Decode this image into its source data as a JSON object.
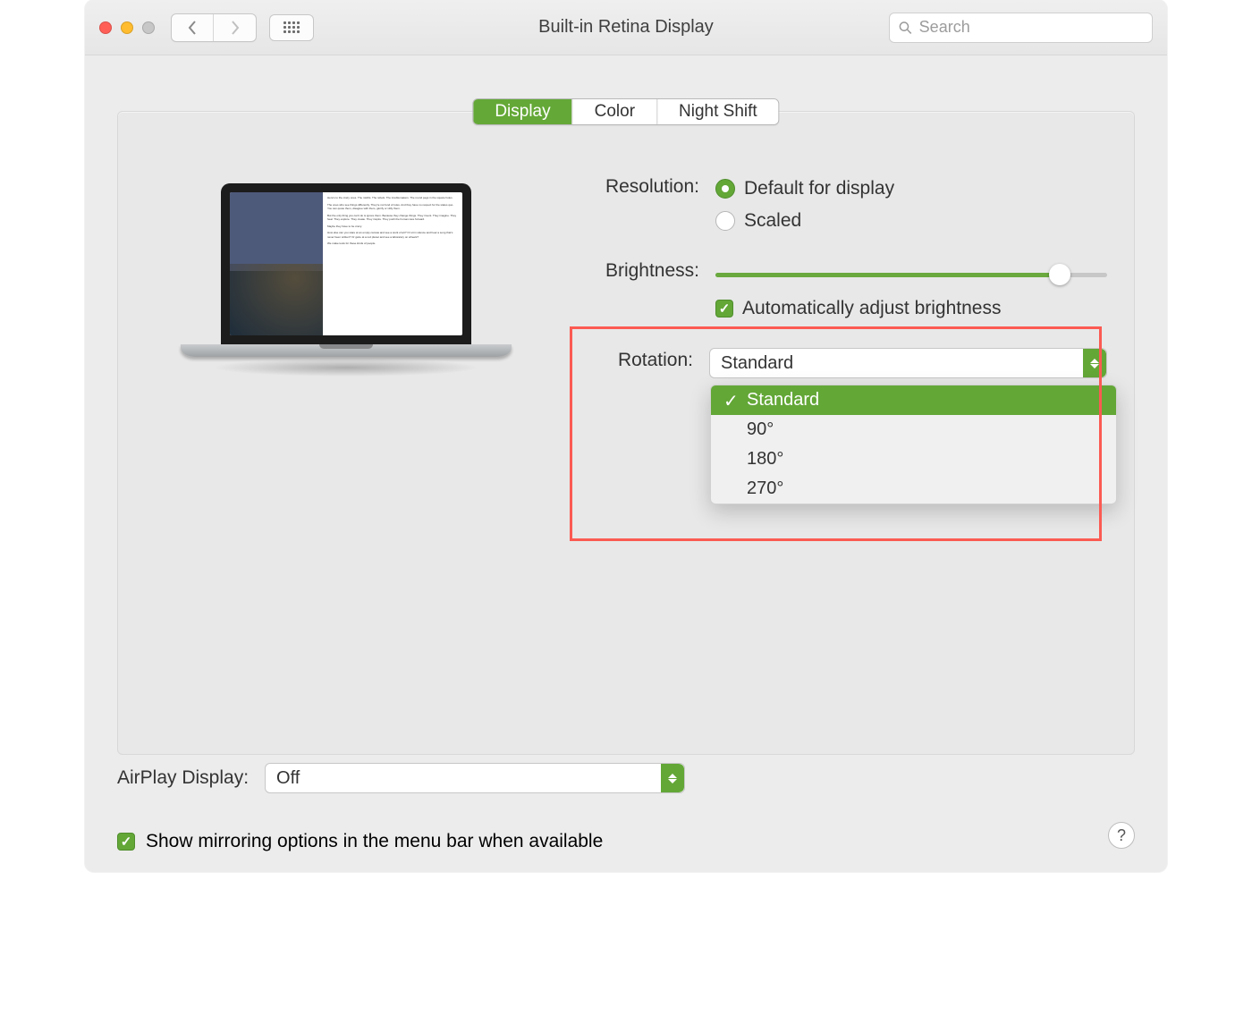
{
  "header": {
    "title": "Built-in Retina Display",
    "search_placeholder": "Search"
  },
  "tabs": {
    "display": "Display",
    "color": "Color",
    "night_shift": "Night Shift"
  },
  "labels": {
    "resolution": "Resolution:",
    "brightness": "Brightness:",
    "rotation": "Rotation:",
    "airplay": "AirPlay Display:"
  },
  "resolution": {
    "default": "Default for display",
    "scaled": "Scaled"
  },
  "brightness": {
    "auto": "Automatically adjust brightness"
  },
  "rotation": {
    "current": "Standard",
    "options": {
      "o0": "Standard",
      "o1": "90°",
      "o2": "180°",
      "o3": "270°"
    }
  },
  "airplay": {
    "current": "Off"
  },
  "mirroring": "Show mirroring options in the menu bar when available",
  "help": "?"
}
